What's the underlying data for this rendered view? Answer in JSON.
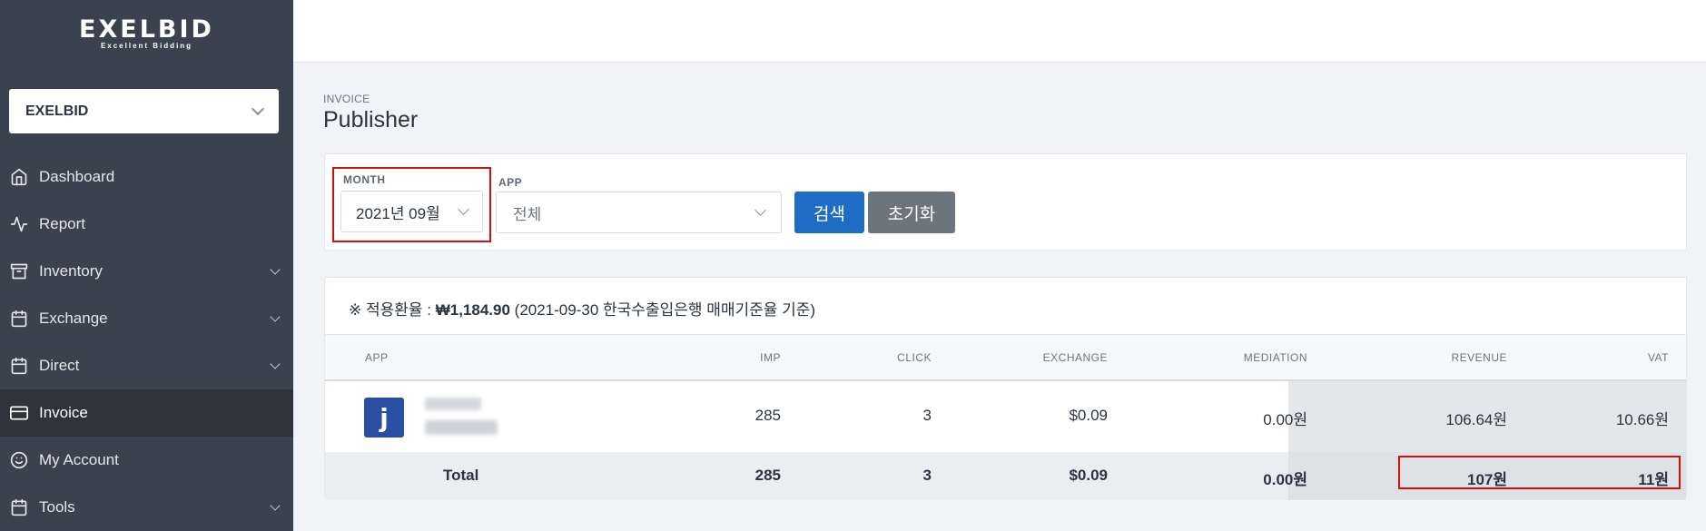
{
  "brand": {
    "logo_main": "EXELBID",
    "logo_sub": "Excellent Bidding"
  },
  "account_selector": {
    "value": "EXELBID"
  },
  "nav": [
    {
      "label": "Dashboard",
      "icon": "home-icon",
      "has_submenu": false,
      "active": false
    },
    {
      "label": "Report",
      "icon": "activity-icon",
      "has_submenu": false,
      "active": false
    },
    {
      "label": "Inventory",
      "icon": "inventory-icon",
      "has_submenu": true,
      "active": false
    },
    {
      "label": "Exchange",
      "icon": "calendar-icon",
      "has_submenu": true,
      "active": false
    },
    {
      "label": "Direct",
      "icon": "calendar-icon",
      "has_submenu": true,
      "active": false
    },
    {
      "label": "Invoice",
      "icon": "credit-card-icon",
      "has_submenu": false,
      "active": true
    },
    {
      "label": "My Account",
      "icon": "smile-icon",
      "has_submenu": false,
      "active": false
    },
    {
      "label": "Tools",
      "icon": "calendar-icon",
      "has_submenu": true,
      "active": false
    }
  ],
  "header": {
    "breadcrumb": "INVOICE",
    "title": "Publisher"
  },
  "filters": {
    "month_label": "MONTH",
    "month_value": "2021년 09월",
    "app_label": "APP",
    "app_value": "전체",
    "search_button": "검색",
    "reset_button": "초기화"
  },
  "exchange_rate": {
    "prefix": "※ 적용환율 : ",
    "rate": "₩1,184.90",
    "note": " (2021-09-30 한국수출입은행 매매기준율 기준)"
  },
  "table": {
    "columns": [
      "APP",
      "IMP",
      "CLICK",
      "EXCHANGE",
      "MEDIATION",
      "REVENUE",
      "VAT"
    ],
    "rows": [
      {
        "app_icon_letter": "j",
        "imp": "285",
        "click": "3",
        "exchange": "$0.09",
        "mediation": "0.00원",
        "revenue": "106.64원",
        "vat": "10.66원"
      }
    ],
    "total": {
      "label": "Total",
      "imp": "285",
      "click": "3",
      "exchange": "$0.09",
      "mediation": "0.00원",
      "revenue": "107원",
      "vat": "11원"
    }
  },
  "colors": {
    "sidebar": "#39424e",
    "primary": "#1f6cc4",
    "secondary": "#6c757d",
    "highlight": "#d30f0f"
  }
}
